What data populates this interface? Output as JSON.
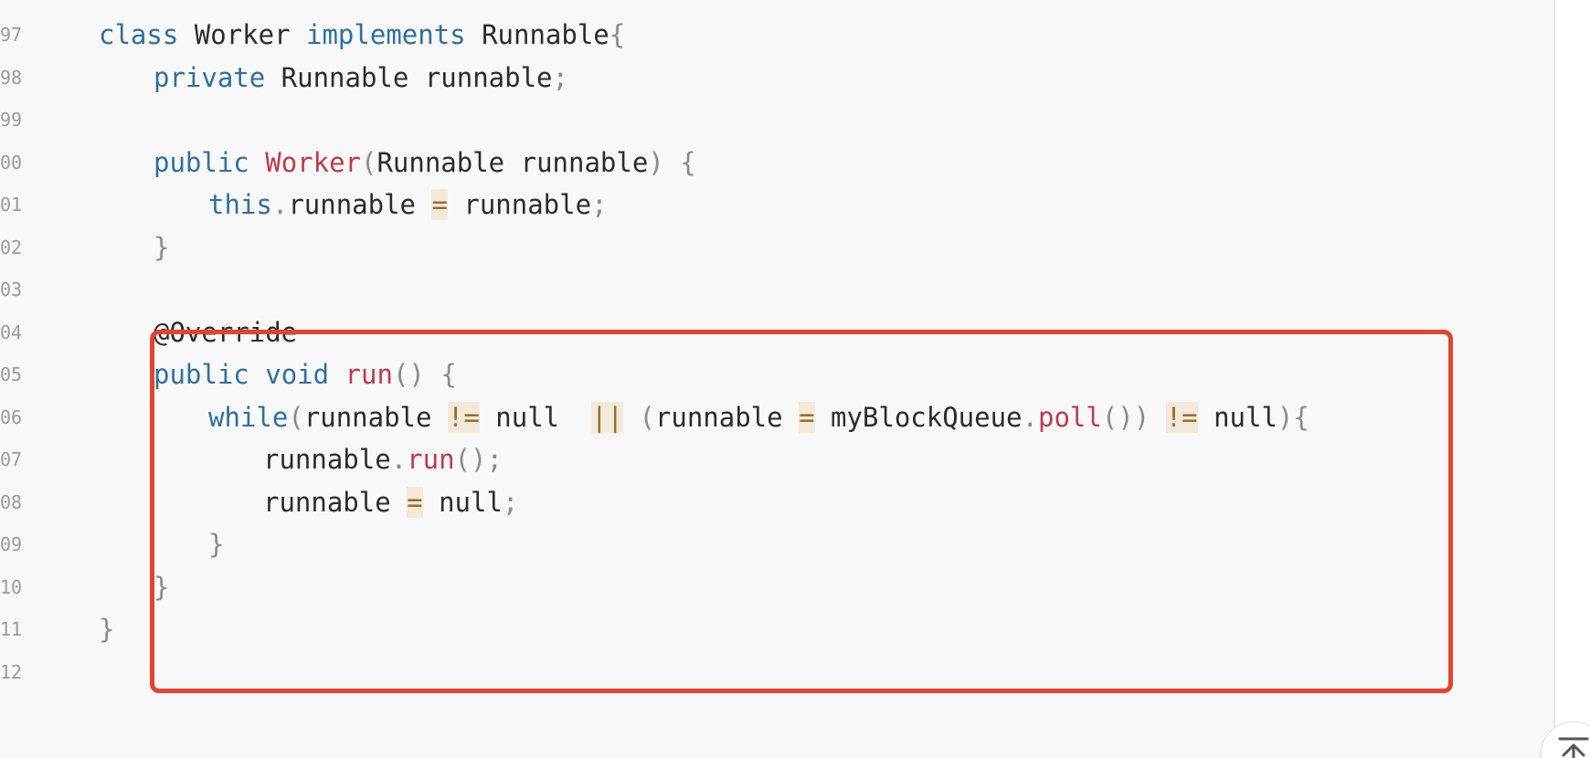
{
  "code_view": {
    "lines": [
      {
        "number": "97",
        "indent": 1,
        "tokens": [
          {
            "t": "class",
            "c": "kw"
          },
          {
            "t": " ",
            "c": "id"
          },
          {
            "t": "Worker",
            "c": "id"
          },
          {
            "t": " ",
            "c": "id"
          },
          {
            "t": "implements",
            "c": "kw"
          },
          {
            "t": " ",
            "c": "id"
          },
          {
            "t": "Runnable",
            "c": "id"
          },
          {
            "t": "{",
            "c": "pn"
          }
        ]
      },
      {
        "number": "98",
        "indent": 2,
        "tokens": [
          {
            "t": "private",
            "c": "kw"
          },
          {
            "t": " Runnable runnable",
            "c": "id"
          },
          {
            "t": ";",
            "c": "pn"
          }
        ]
      },
      {
        "number": "99",
        "indent": 0,
        "tokens": []
      },
      {
        "number": "00",
        "indent": 2,
        "tokens": [
          {
            "t": "public",
            "c": "kw"
          },
          {
            "t": " ",
            "c": "id"
          },
          {
            "t": "Worker",
            "c": "fn"
          },
          {
            "t": "(",
            "c": "pn"
          },
          {
            "t": "Runnable runnable",
            "c": "id"
          },
          {
            "t": ")",
            "c": "pn"
          },
          {
            "t": " ",
            "c": "id"
          },
          {
            "t": "{",
            "c": "pn"
          }
        ]
      },
      {
        "number": "01",
        "indent": 3,
        "tokens": [
          {
            "t": "this",
            "c": "kw"
          },
          {
            "t": ".",
            "c": "pn"
          },
          {
            "t": "runnable ",
            "c": "id"
          },
          {
            "t": "=",
            "c": "op"
          },
          {
            "t": " runnable",
            "c": "id"
          },
          {
            "t": ";",
            "c": "pn"
          }
        ]
      },
      {
        "number": "02",
        "indent": 2,
        "tokens": [
          {
            "t": "}",
            "c": "pn"
          }
        ]
      },
      {
        "number": "03",
        "indent": 0,
        "tokens": []
      },
      {
        "number": "04",
        "indent": 2,
        "tokens": [
          {
            "t": "@Override",
            "c": "id"
          }
        ]
      },
      {
        "number": "05",
        "indent": 2,
        "tokens": [
          {
            "t": "public",
            "c": "kw"
          },
          {
            "t": " ",
            "c": "id"
          },
          {
            "t": "void",
            "c": "kw"
          },
          {
            "t": " ",
            "c": "id"
          },
          {
            "t": "run",
            "c": "fn"
          },
          {
            "t": "()",
            "c": "pn"
          },
          {
            "t": " ",
            "c": "id"
          },
          {
            "t": "{",
            "c": "pn"
          }
        ]
      },
      {
        "number": "06",
        "indent": 3,
        "tokens": [
          {
            "t": "while",
            "c": "kw"
          },
          {
            "t": "(",
            "c": "pn"
          },
          {
            "t": "runnable ",
            "c": "id"
          },
          {
            "t": "!=",
            "c": "op"
          },
          {
            "t": " null  ",
            "c": "id"
          },
          {
            "t": "||",
            "c": "op"
          },
          {
            "t": " ",
            "c": "id"
          },
          {
            "t": "(",
            "c": "pn"
          },
          {
            "t": "runnable ",
            "c": "id"
          },
          {
            "t": "=",
            "c": "op"
          },
          {
            "t": " myBlockQueue",
            "c": "id"
          },
          {
            "t": ".",
            "c": "pn"
          },
          {
            "t": "poll",
            "c": "fn"
          },
          {
            "t": "())",
            "c": "pn"
          },
          {
            "t": " ",
            "c": "id"
          },
          {
            "t": "!=",
            "c": "op"
          },
          {
            "t": " null",
            "c": "id"
          },
          {
            "t": "){",
            "c": "pn"
          }
        ]
      },
      {
        "number": "07",
        "indent": 4,
        "tokens": [
          {
            "t": "runnable",
            "c": "id"
          },
          {
            "t": ".",
            "c": "pn"
          },
          {
            "t": "run",
            "c": "fn"
          },
          {
            "t": "();",
            "c": "pn"
          }
        ]
      },
      {
        "number": "08",
        "indent": 4,
        "tokens": [
          {
            "t": "runnable ",
            "c": "id"
          },
          {
            "t": "=",
            "c": "op"
          },
          {
            "t": " null",
            "c": "id"
          },
          {
            "t": ";",
            "c": "pn"
          }
        ]
      },
      {
        "number": "09",
        "indent": 3,
        "tokens": [
          {
            "t": "}",
            "c": "pn"
          }
        ]
      },
      {
        "number": "10",
        "indent": 2,
        "tokens": [
          {
            "t": "}",
            "c": "pn"
          }
        ]
      },
      {
        "number": "11",
        "indent": 1,
        "tokens": [
          {
            "t": "}",
            "c": "pn"
          }
        ]
      },
      {
        "number": "12",
        "indent": 0,
        "tokens": []
      }
    ],
    "highlight_color": "#e5432d"
  },
  "back_to_top": {
    "icon": "arrow-up-to-line-icon"
  }
}
